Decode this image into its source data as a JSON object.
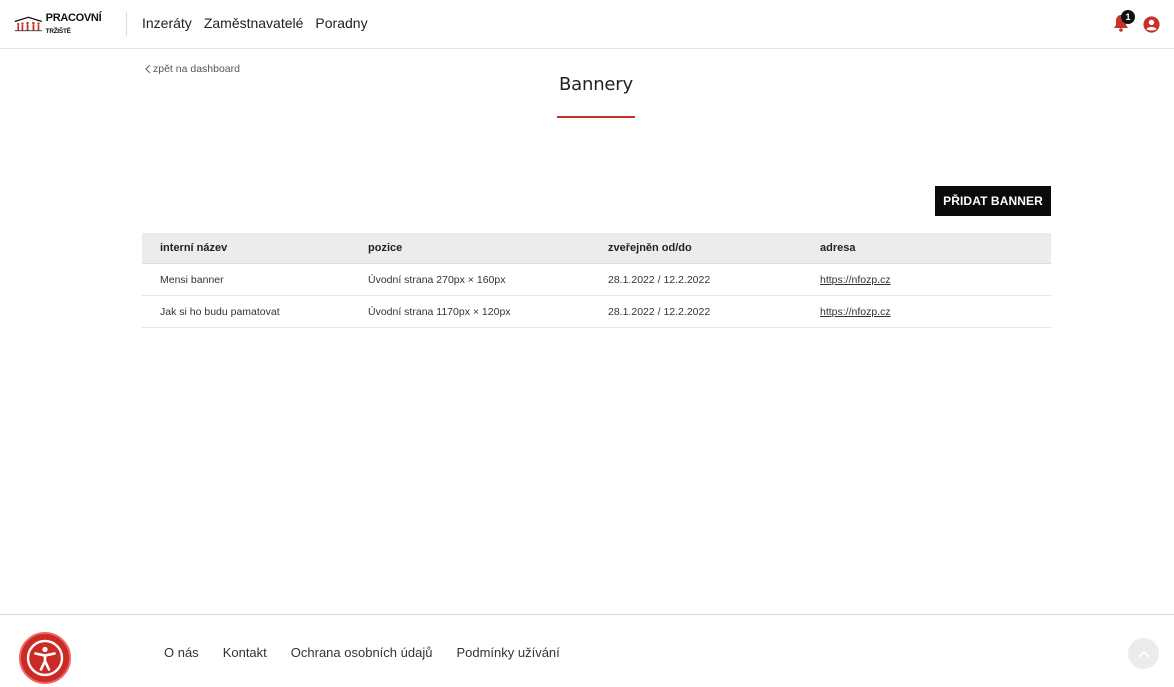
{
  "header": {
    "logo_text": "PRACOVNÍ",
    "logo_small": "TRŽIŠTĚ",
    "nav": [
      {
        "label": "Inzeráty"
      },
      {
        "label": "Zaměstnavatelé"
      },
      {
        "label": "Poradny"
      }
    ],
    "notification_count": "1"
  },
  "main": {
    "back_label": "zpět na dashboard",
    "title": "Bannery",
    "add_button_label": "PŘIDAT BANNER",
    "table": {
      "columns": [
        "interní název",
        "pozice",
        "zveřejněn od/do",
        "adresa"
      ],
      "rows": [
        {
          "name": "Mensi banner",
          "position": "Úvodní strana 270px × 160px",
          "published": "28.1.2022 / 12.2.2022",
          "url": "https://nfozp.cz"
        },
        {
          "name": "Jak si ho budu pamatovat",
          "position": "Úvodní strana 1170px × 120px",
          "published": "28.1.2022 / 12.2.2022",
          "url": "https://nfozp.cz"
        }
      ]
    }
  },
  "footer": {
    "links": [
      {
        "label": "O nás"
      },
      {
        "label": "Kontakt"
      },
      {
        "label": "Ochrana osobních údajů"
      },
      {
        "label": "Podmínky užívání"
      }
    ]
  },
  "colors": {
    "accent": "#c8312a",
    "button_bg": "#0b0b0b",
    "table_header_bg": "#ececec"
  },
  "icons": [
    "logo-figures-icon",
    "bell-icon",
    "user-circle-icon",
    "chevron-left-icon",
    "accessibility-icon",
    "arrow-up-icon"
  ]
}
